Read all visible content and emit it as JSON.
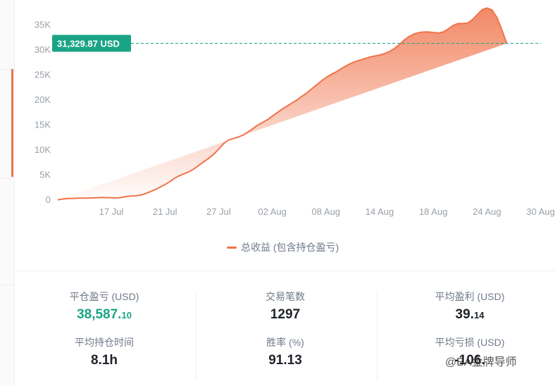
{
  "chart_data": {
    "type": "area",
    "title": "",
    "xlabel": "",
    "ylabel": "",
    "ylim": [
      0,
      40000
    ],
    "yticks": [
      0,
      5000,
      10000,
      15000,
      20000,
      25000,
      30000,
      35000
    ],
    "ytick_labels": [
      "0",
      "5K",
      "10K",
      "15K",
      "20K",
      "25K",
      "30K",
      "35K"
    ],
    "xtick_labels": [
      "17 Jul",
      "21 Jul",
      "27 Jul",
      "02 Aug",
      "08 Aug",
      "14 Aug",
      "18 Aug",
      "24 Aug",
      "30 Aug"
    ],
    "x": [
      0,
      3,
      6,
      9,
      12,
      15,
      18,
      21,
      24,
      27,
      30,
      33,
      36,
      39,
      42,
      45,
      48,
      51,
      54,
      57,
      60,
      63,
      66,
      69,
      72,
      75,
      78,
      81,
      84,
      87,
      90,
      93,
      96,
      99,
      102,
      105,
      108,
      111,
      114,
      117,
      120,
      123,
      126,
      129,
      132,
      135,
      138,
      141,
      144,
      147,
      150,
      153,
      156,
      159,
      162,
      165,
      168,
      171,
      174,
      177,
      180,
      183,
      186,
      189,
      192,
      195,
      198,
      201,
      204,
      207,
      210,
      213,
      216,
      219,
      222,
      225,
      228,
      231,
      234,
      237,
      240,
      243,
      246,
      249,
      252,
      255,
      258,
      261,
      264,
      267,
      270,
      273,
      276,
      279,
      282,
      285,
      288,
      291,
      294,
      297
    ],
    "y": [
      50,
      200,
      300,
      330,
      360,
      380,
      400,
      420,
      460,
      500,
      480,
      450,
      420,
      500,
      700,
      800,
      850,
      1000,
      1300,
      1700,
      2100,
      2600,
      3100,
      3700,
      4400,
      4900,
      5300,
      5700,
      6300,
      7000,
      7700,
      8400,
      9200,
      10200,
      11300,
      12000,
      12300,
      12600,
      13000,
      13600,
      14300,
      15000,
      15500,
      16100,
      16800,
      17500,
      18200,
      18800,
      19400,
      20000,
      20700,
      21400,
      22200,
      23000,
      23800,
      24500,
      25100,
      25600,
      26200,
      26800,
      27300,
      27700,
      28000,
      28300,
      28600,
      28800,
      29000,
      29300,
      29700,
      30300,
      31100,
      32000,
      32700,
      33200,
      33500,
      33600,
      33600,
      33500,
      33400,
      33600,
      34200,
      34900,
      35300,
      35300,
      35400,
      36100,
      37100,
      38100,
      38400,
      38000,
      36500,
      34000,
      31329.87
    ],
    "series": [
      {
        "name": "总收益 (包含持仓盈亏)",
        "color": "#f0734a"
      }
    ],
    "current_value_label": "31,329.87 USD",
    "current_value": 31329.87,
    "grid": false,
    "legend_position": "bottom-center"
  },
  "legend": {
    "label": "总收益 (包含持仓盈亏)"
  },
  "stats": {
    "closed_pnl": {
      "label": "平仓盈亏 (USD)",
      "value_main": "38,587.",
      "value_small": "10"
    },
    "trade_count": {
      "label": "交易笔数",
      "value": "1297"
    },
    "avg_profit": {
      "label": "平均盈利 (USD)",
      "value_main": "39.",
      "value_small": "14"
    },
    "avg_hold_time": {
      "label": "平均持仓时间",
      "value": "8.1h"
    },
    "win_rate": {
      "label": "胜率 (%)",
      "value": "91.13"
    },
    "avg_loss": {
      "label": "平均亏损 (USD)",
      "value": "-106."
    }
  },
  "watermark": {
    "text": "@BA金牌导师"
  },
  "colors": {
    "accent": "#f0734a",
    "label_bg": "#1aa486",
    "profit_green": "#1aa486"
  }
}
